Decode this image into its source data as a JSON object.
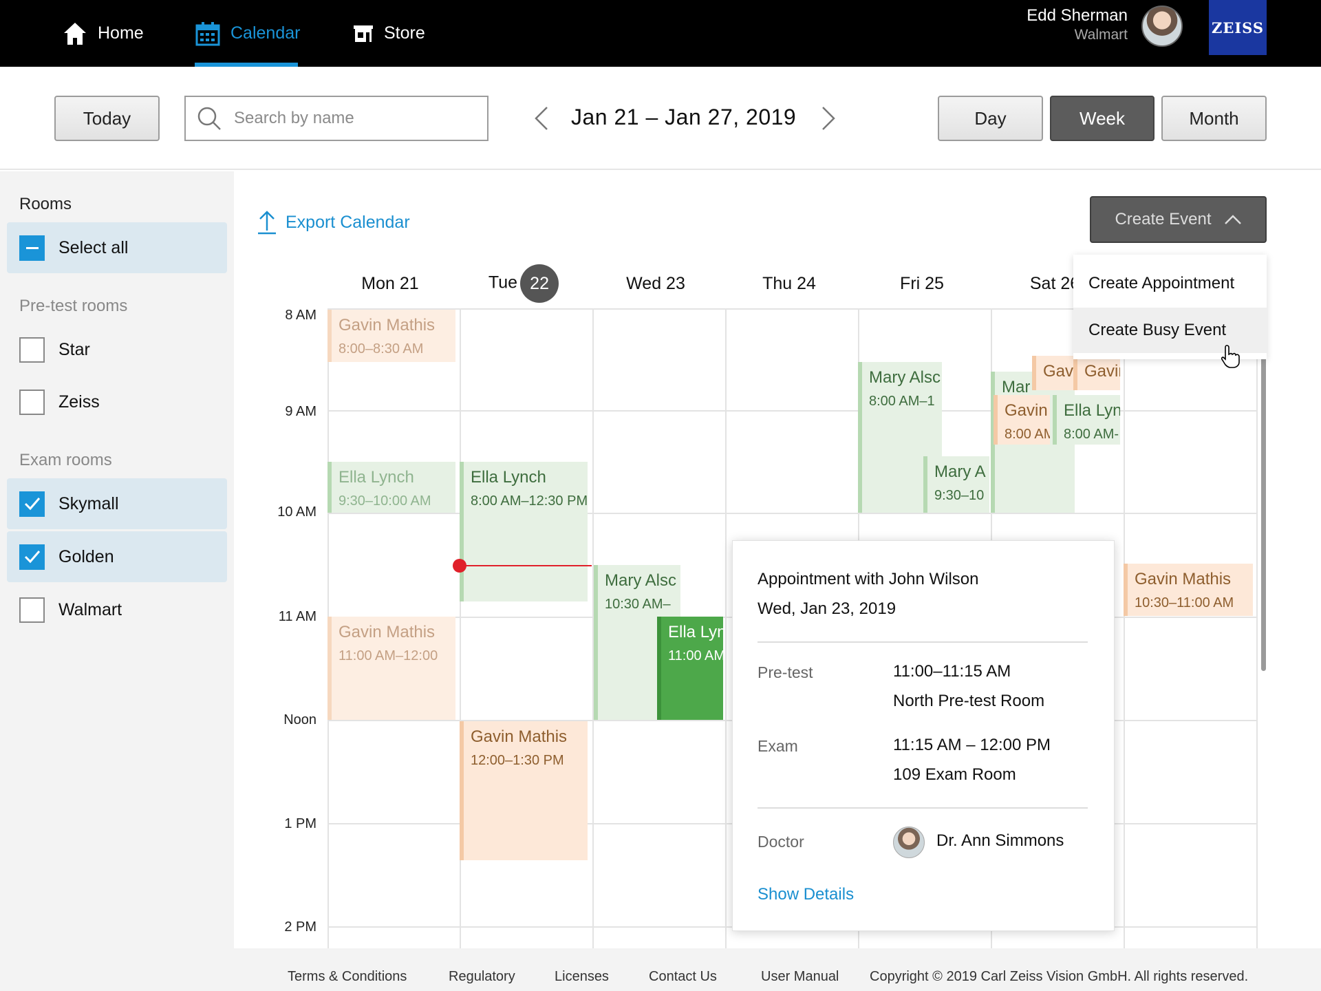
{
  "nav": {
    "home": "Home",
    "calendar": "Calendar",
    "store": "Store",
    "user_name": "Edd Sherman",
    "user_org": "Walmart",
    "logo": "ZEISS"
  },
  "toolbar": {
    "today": "Today",
    "search_placeholder": "Search by name",
    "date_range": "Jan 21 – Jan 27, 2019",
    "view_day": "Day",
    "view_week": "Week",
    "view_month": "Month",
    "selected_view": "Week"
  },
  "sidebar": {
    "title": "Rooms",
    "select_all": "Select all",
    "pretest_title": "Pre-test rooms",
    "pretest_rooms": [
      {
        "label": "Star",
        "checked": false
      },
      {
        "label": "Zeiss",
        "checked": false
      }
    ],
    "exam_title": "Exam rooms",
    "exam_rooms": [
      {
        "label": "Skymall",
        "checked": true
      },
      {
        "label": "Golden",
        "checked": true
      },
      {
        "label": "Walmart",
        "checked": false
      }
    ]
  },
  "main": {
    "export": "Export Calendar",
    "create_event": "Create Event",
    "days": [
      {
        "label": "Mon 21"
      },
      {
        "label": "Tue",
        "badge": "22"
      },
      {
        "label": "Wed 23"
      },
      {
        "label": "Thu 24"
      },
      {
        "label": "Fri 25"
      },
      {
        "label": "Sat 26"
      }
    ],
    "times": [
      "8 AM",
      "9 AM",
      "10 AM",
      "11 AM",
      "Noon",
      "1 PM",
      "2 PM"
    ],
    "events": [
      {
        "name": "Gavin Mathis",
        "time": "8:00–8:30 AM"
      },
      {
        "name": "Ella Lynch",
        "time": "9:30–10:00 AM"
      },
      {
        "name": "Gavin Mathis",
        "time": "11:00 AM–12:00"
      },
      {
        "name": "Ella Lynch",
        "time": "8:00 AM–12:30 PM"
      },
      {
        "name": "Gavin Mathis",
        "time": "12:00–1:30 PM"
      },
      {
        "name": "Mary Alsc",
        "time": "10:30 AM–"
      },
      {
        "name": "Ella Lyn",
        "time": "11:00 AM"
      },
      {
        "name": "Mary Alsc",
        "time": "8:00 AM–1"
      },
      {
        "name": "Mary A",
        "time": "9:30–10"
      },
      {
        "name": "Mar",
        "time": ""
      },
      {
        "name": "Gav",
        "time": ""
      },
      {
        "name": "Gavin",
        "time": ""
      },
      {
        "name": "Gavin",
        "time": "8:00 AM"
      },
      {
        "name": "Ella Lyn",
        "time": "8:00 AM-"
      },
      {
        "name": "Gavin Mathis",
        "time": "10:30–11:00 AM"
      }
    ]
  },
  "dropdown": {
    "items": [
      "Create Appointment",
      "Create Busy Event"
    ]
  },
  "popover": {
    "title": "Appointment with John Wilson",
    "date": "Wed, Jan 23, 2019",
    "pretest_label": "Pre-test",
    "pretest_time": "11:00–11:15 AM",
    "pretest_room": "North Pre-test Room",
    "exam_label": "Exam",
    "exam_time": "11:15 AM – 12:00 PM",
    "exam_room": "109 Exam Room",
    "doctor_label": "Doctor",
    "doctor_name": "Dr. Ann Simmons",
    "show_details": "Show Details"
  },
  "footer": {
    "links": [
      "Terms & Conditions",
      "Regulatory",
      "Licenses",
      "Contact Us",
      "User Manual"
    ],
    "copyright": "Copyright © 2019 Carl Zeiss Vision GmbH. All rights reserved."
  },
  "colors": {
    "accent": "#1a94d8",
    "appointment_orange": "#fde8d8",
    "appointment_green": "#e6f1e4",
    "now_line": "#e0202a"
  }
}
